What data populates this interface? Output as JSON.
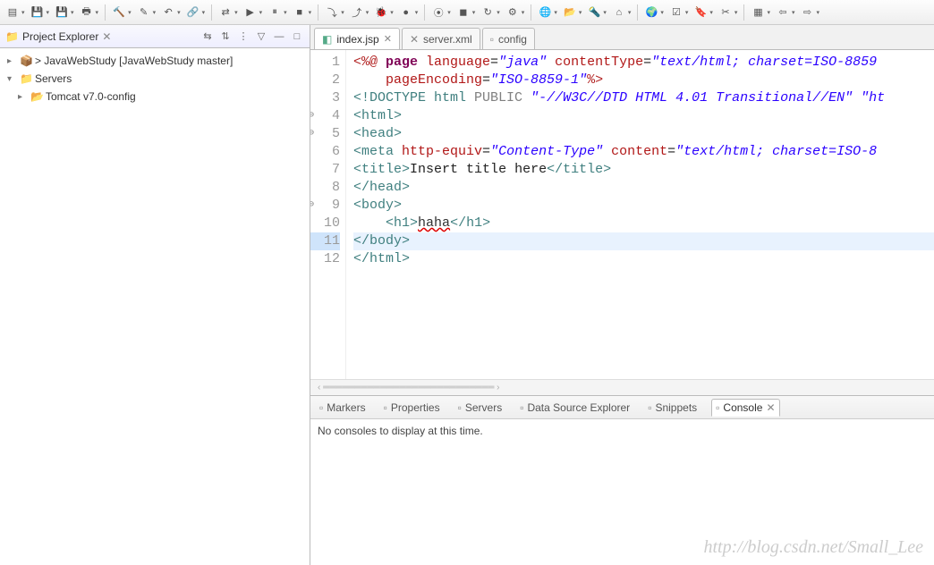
{
  "toolbar": {
    "icons": [
      "new",
      "save",
      "save-all",
      "print",
      "build",
      "edit",
      "undo",
      "link",
      "swap",
      "play",
      "pause",
      "stop",
      "step",
      "step-over",
      "bug",
      "run",
      "run-ext",
      "stop2",
      "refresh",
      "plugin",
      "browser",
      "open-folder",
      "search",
      "home",
      "globe",
      "task",
      "tag",
      "cut",
      "perspective",
      "prev",
      "next"
    ]
  },
  "project_explorer": {
    "title": "Project Explorer",
    "items": [
      {
        "label": "> JavaWebStudy [JavaWebStudy master]",
        "icon": "project",
        "level": 0,
        "expand": ">"
      },
      {
        "label": "Servers",
        "icon": "folder",
        "level": 0,
        "expand": "v"
      },
      {
        "label": "Tomcat v7.0-config",
        "icon": "folder-open",
        "level": 1,
        "expand": ">"
      }
    ]
  },
  "editor_tabs": [
    {
      "label": "index.jsp",
      "active": true,
      "dirty": false,
      "icon": "jsp"
    },
    {
      "label": "server.xml",
      "active": false,
      "icon": "xml"
    },
    {
      "label": "config",
      "active": false,
      "icon": "file"
    }
  ],
  "editor": {
    "current_line": 11,
    "lines": [
      {
        "n": 1,
        "tokens": [
          [
            "<%@ ",
            "t-dir"
          ],
          [
            "page ",
            "t-kw"
          ],
          [
            "language",
            "t-attr"
          ],
          [
            "=",
            "t-txt"
          ],
          [
            "\"java\"",
            "t-str"
          ],
          [
            " contentType",
            "t-attr"
          ],
          [
            "=",
            "t-txt"
          ],
          [
            "\"text/html; charset=ISO-8859",
            "t-str"
          ]
        ]
      },
      {
        "n": 2,
        "tokens": [
          [
            "    pageEncoding",
            "t-attr"
          ],
          [
            "=",
            "t-txt"
          ],
          [
            "\"ISO-8859-1\"",
            "t-str"
          ],
          [
            "%>",
            "t-dir"
          ]
        ]
      },
      {
        "n": 3,
        "tokens": [
          [
            "<!",
            "t-doc"
          ],
          [
            "DOCTYPE ",
            "t-doc"
          ],
          [
            "html ",
            "t-tag"
          ],
          [
            "PUBLIC ",
            "t-gray"
          ],
          [
            "\"-//W3C//DTD HTML 4.01 Transitional//EN\" \"ht",
            "t-str"
          ]
        ]
      },
      {
        "n": 4,
        "fold": true,
        "tokens": [
          [
            "<",
            "t-tag"
          ],
          [
            "html",
            "t-tag"
          ],
          [
            ">",
            "t-tag"
          ]
        ]
      },
      {
        "n": 5,
        "fold": true,
        "tokens": [
          [
            "<",
            "t-tag"
          ],
          [
            "head",
            "t-tag"
          ],
          [
            ">",
            "t-tag"
          ]
        ]
      },
      {
        "n": 6,
        "tokens": [
          [
            "<",
            "t-tag"
          ],
          [
            "meta ",
            "t-tag"
          ],
          [
            "http-equiv",
            "t-attr"
          ],
          [
            "=",
            "t-txt"
          ],
          [
            "\"Content-Type\"",
            "t-str"
          ],
          [
            " content",
            "t-attr"
          ],
          [
            "=",
            "t-txt"
          ],
          [
            "\"text/html; charset=ISO-8",
            "t-str"
          ]
        ]
      },
      {
        "n": 7,
        "tokens": [
          [
            "<",
            "t-tag"
          ],
          [
            "title",
            "t-tag"
          ],
          [
            ">",
            "t-tag"
          ],
          [
            "Insert title here",
            "t-txt"
          ],
          [
            "</",
            "t-tag"
          ],
          [
            "title",
            "t-tag"
          ],
          [
            ">",
            "t-tag"
          ]
        ]
      },
      {
        "n": 8,
        "tokens": [
          [
            "</",
            "t-tag"
          ],
          [
            "head",
            "t-tag"
          ],
          [
            ">",
            "t-tag"
          ]
        ]
      },
      {
        "n": 9,
        "fold": true,
        "tokens": [
          [
            "<",
            "t-tag"
          ],
          [
            "body",
            "t-tag"
          ],
          [
            ">",
            "t-tag"
          ]
        ]
      },
      {
        "n": 10,
        "tokens": [
          [
            "    <",
            "t-tag"
          ],
          [
            "h1",
            "t-h1"
          ],
          [
            ">",
            "t-tag"
          ],
          [
            "haha",
            "t-err"
          ],
          [
            "</",
            "t-tag"
          ],
          [
            "h1",
            "t-h1"
          ],
          [
            ">",
            "t-tag"
          ]
        ]
      },
      {
        "n": 11,
        "tokens": [
          [
            "</",
            "t-tag"
          ],
          [
            "body",
            "t-tag"
          ],
          [
            ">",
            "t-tag"
          ]
        ]
      },
      {
        "n": 12,
        "tokens": [
          [
            "</",
            "t-tag"
          ],
          [
            "html",
            "t-tag"
          ],
          [
            ">",
            "t-tag"
          ]
        ]
      }
    ]
  },
  "bottom_tabs": [
    {
      "label": "Markers",
      "icon": "markers"
    },
    {
      "label": "Properties",
      "icon": "props"
    },
    {
      "label": "Servers",
      "icon": "servers"
    },
    {
      "label": "Data Source Explorer",
      "icon": "dse"
    },
    {
      "label": "Snippets",
      "icon": "snippets"
    },
    {
      "label": "Console",
      "icon": "console",
      "active": true
    }
  ],
  "console_message": "No consoles to display at this time.",
  "watermark": "http://blog.csdn.net/Small_Lee"
}
